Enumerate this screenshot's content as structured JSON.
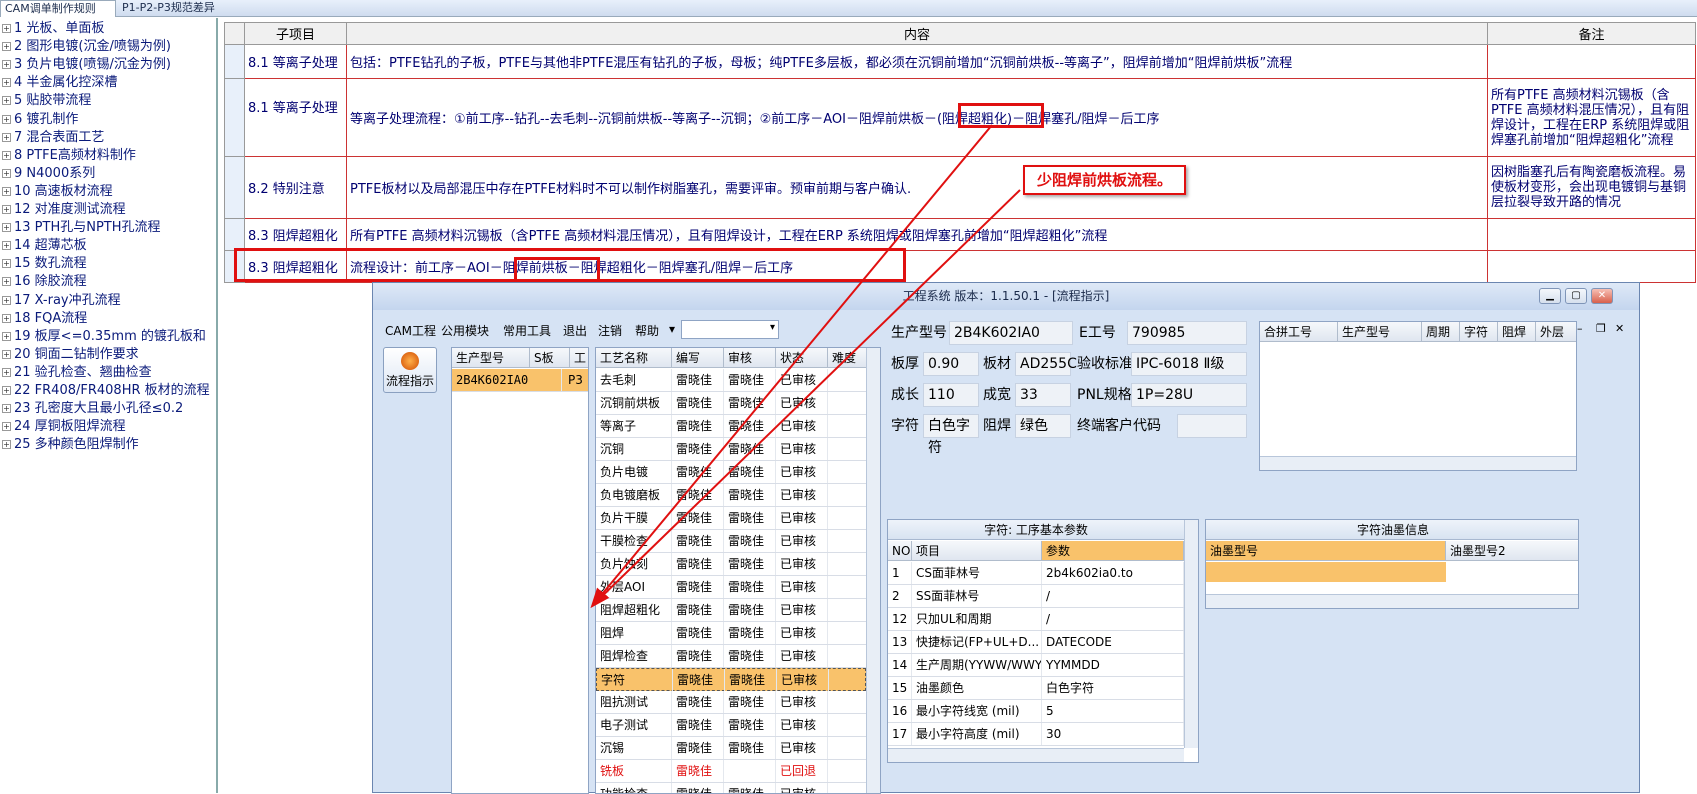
{
  "tabs": [
    "CAM调单制作规则",
    "P1-P2-P3规范差异"
  ],
  "tree": [
    "1 光板、单面板",
    "2 图形电镀(沉金/喷锡为例)",
    "3 负片电镀(喷锡/沉金为例)",
    "4 半金属化控深槽",
    "5 贴胶带流程",
    "6 镀孔制作",
    "7 混合表面工艺",
    "8 PTFE高频材料制作",
    "9 N4000系列",
    "10 高速板材流程",
    "12 对准度测试流程",
    "13 PTH孔与NPTH孔流程",
    "14 超薄芯板",
    "15 数孔流程",
    "16 除胶流程",
    "17 X-ray冲孔流程",
    "18 FQA流程",
    "19 板厚<=0.35mm 的镀孔板和",
    "20 铜面二钻制作要求",
    "21 验孔检查、翘曲检查",
    "22 FR408/FR408HR 板材的流程",
    "23 孔密度大且最小孔径≤0.2",
    "24 厚铜板阻焊流程",
    "25 多种颜色阻焊制作"
  ],
  "spec_table": {
    "headers": [
      "子项目",
      "内容",
      "备注"
    ],
    "rows": [
      {
        "sub": "8.1 等离子处理",
        "content": "包括：PTFE钻孔的子板，PTFE与其他非PTFE混压有钻孔的子板，母板；纯PTFE多层板，都必须在沉铜前增加“沉铜前烘板--等离子”，阻焊前增加“阻焊前烘板”流程",
        "note": ""
      },
      {
        "sub": "8.1 等离子处理",
        "content": "等离子处理流程：①前工序--钻孔--去毛刺--沉铜前烘板--等离子--沉铜；②前工序－AOI－阻焊前烘板－(阻焊超粗化)－阻焊塞孔/阻焊－后工序",
        "note": "所有PTFE 高频材料沉锡板（含PTFE 高频材料混压情况），且有阻焊设计，工程在ERP 系统阻焊或阻焊塞孔前增加“阻焊超粗化”流程"
      },
      {
        "sub": "8.2 特别注意",
        "content": "PTFE板材以及局部混压中存在PTFE材料时不可以制作树脂塞孔，需要评审。预审前期与客户确认.",
        "note": "因树脂塞孔后有陶瓷磨板流程。易使板材变形，会出现电镀铜与基铜层拉裂导致开路的情况"
      },
      {
        "sub": "8.3 阻焊超粗化",
        "content": "所有PTFE 高频材料沉锡板（含PTFE 高频材料混压情况），且有阻焊设计，工程在ERP 系统阻焊或阻焊塞孔前增加“阻焊超粗化”流程",
        "note": ""
      },
      {
        "sub": "8.3 阻焊超粗化",
        "content": "流程设计：前工序－AOI－阻焊前烘板－阻焊超粗化－阻焊塞孔/阻焊－后工序",
        "note": ""
      }
    ]
  },
  "callout": "少阻焊前烘板流程。",
  "window": {
    "title": "工程系统   版本：1.1.50.1 - [流程指示]",
    "menu": [
      "CAM工程",
      "公用模块",
      "常用工具",
      "退出",
      "注销",
      "帮助"
    ],
    "tool_button": "流程指示",
    "model_grid": {
      "headers": [
        "生产型号",
        "S板",
        "工"
      ],
      "rows": [
        [
          "2B4K602IA0",
          "P3",
          ""
        ]
      ]
    },
    "process_grid": {
      "headers": [
        "工艺名称",
        "编写",
        "审核",
        "状态",
        "难度"
      ],
      "rows": [
        [
          "去毛刺",
          "雷晓佳",
          "雷晓佳",
          "已审核"
        ],
        [
          "沉铜前烘板",
          "雷晓佳",
          "雷晓佳",
          "已审核"
        ],
        [
          "等离子",
          "雷晓佳",
          "雷晓佳",
          "已审核"
        ],
        [
          "沉铜",
          "雷晓佳",
          "雷晓佳",
          "已审核"
        ],
        [
          "负片电镀",
          "雷晓佳",
          "雷晓佳",
          "已审核"
        ],
        [
          "负电镀磨板",
          "雷晓佳",
          "雷晓佳",
          "已审核"
        ],
        [
          "负片干膜",
          "雷晓佳",
          "雷晓佳",
          "已审核"
        ],
        [
          "干膜检查",
          "雷晓佳",
          "雷晓佳",
          "已审核"
        ],
        [
          "负片蚀刻",
          "雷晓佳",
          "雷晓佳",
          "已审核"
        ],
        [
          "外层AOI",
          "雷晓佳",
          "雷晓佳",
          "已审核"
        ],
        [
          "阻焊超粗化",
          "雷晓佳",
          "雷晓佳",
          "已审核"
        ],
        [
          "阻焊",
          "雷晓佳",
          "雷晓佳",
          "已审核"
        ],
        [
          "阻焊检查",
          "雷晓佳",
          "雷晓佳",
          "已审核"
        ],
        [
          "字符",
          "雷晓佳",
          "雷晓佳",
          "已审核"
        ],
        [
          "阻抗测试",
          "雷晓佳",
          "雷晓佳",
          "已审核"
        ],
        [
          "电子测试",
          "雷晓佳",
          "雷晓佳",
          "已审核"
        ],
        [
          "沉锡",
          "雷晓佳",
          "雷晓佳",
          "已审核"
        ],
        [
          "铣板",
          "雷晓佳",
          "",
          "已回退"
        ],
        [
          "功能检查",
          "雷晓佳",
          "雷晓佳",
          "已审核"
        ]
      ],
      "selected": "字符"
    },
    "info": {
      "labels": [
        "生产型号",
        "E工号",
        "板厚",
        "板材",
        "验收标准",
        "成长",
        "成宽",
        "PNL规格",
        "字符",
        "阻焊",
        "终端客户代码"
      ],
      "values": {
        "model": "2B4K602IA0",
        "eno": "790985",
        "thickness": "0.90",
        "material": "AD255C",
        "standard": "IPC-6018 Ⅱ级",
        "length": "110",
        "width": "33",
        "pnl": "1P=28U",
        "char": "白色字符",
        "mask": "绿色",
        "client": ""
      }
    },
    "merge_grid": {
      "headers": [
        "合拼工号",
        "生产型号",
        "周期",
        "字符",
        "阻焊",
        "外层"
      ]
    },
    "param_panel": {
      "title": "字符: 工序基本参数",
      "headers": [
        "NO",
        "项目",
        "参数"
      ],
      "rows": [
        [
          "1",
          "CS面菲林号",
          "2b4k602ia0.to"
        ],
        [
          "2",
          "SS面菲林号",
          "/"
        ],
        [
          "12",
          "只加UL和周期",
          "/"
        ],
        [
          "13",
          "快捷标记(FP+UL+D...",
          "DATECODE"
        ],
        [
          "14",
          "生产周期(YYWW/WWYY)",
          "YYMMDD"
        ],
        [
          "15",
          "油墨颜色",
          "白色字符"
        ],
        [
          "16",
          "最小字符线宽 (mil)",
          "5"
        ],
        [
          "17",
          "最小字符高度 (mil)",
          "30"
        ]
      ]
    },
    "ink_panel": {
      "title": "字符油墨信息",
      "headers": [
        "油墨型号",
        "油墨型号2"
      ]
    }
  }
}
